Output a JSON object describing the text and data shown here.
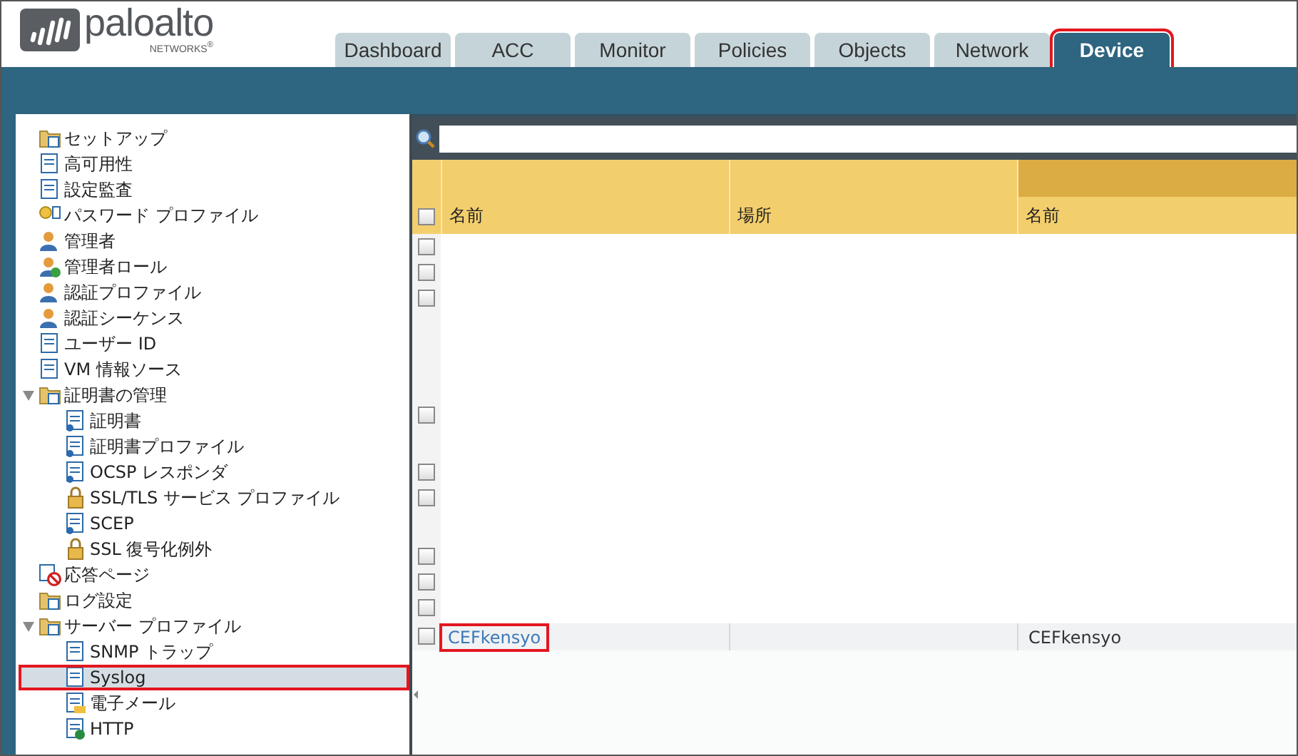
{
  "logo": {
    "name": "paloalto",
    "subtitle": "NETWORKS$^{®}$"
  },
  "tabs": [
    {
      "label": "Dashboard",
      "selected": false,
      "highlighted": false
    },
    {
      "label": "ACC",
      "selected": false,
      "highlighted": false
    },
    {
      "label": "Monitor",
      "selected": false,
      "highlighted": false
    },
    {
      "label": "Policies",
      "selected": false,
      "highlighted": false
    },
    {
      "label": "Objects",
      "selected": false,
      "highlighted": false
    },
    {
      "label": "Network",
      "selected": false,
      "highlighted": false
    },
    {
      "label": "Device",
      "selected": true,
      "highlighted": true
    }
  ],
  "sidebar": {
    "items": [
      {
        "label": "セットアップ",
        "selected": false,
        "highlighted": false
      },
      {
        "label": "高可用性",
        "selected": false,
        "highlighted": false
      },
      {
        "label": "設定監査",
        "selected": false,
        "highlighted": false
      },
      {
        "label": "パスワード プロファイル",
        "selected": false,
        "highlighted": false
      },
      {
        "label": "管理者",
        "selected": false,
        "highlighted": false
      },
      {
        "label": "管理者ロール",
        "selected": false,
        "highlighted": false
      },
      {
        "label": "認証プロファイル",
        "selected": false,
        "highlighted": false
      },
      {
        "label": "認証シーケンス",
        "selected": false,
        "highlighted": false
      },
      {
        "label": "ユーザー ID",
        "selected": false,
        "highlighted": false
      },
      {
        "label": "VM 情報ソース",
        "selected": false,
        "highlighted": false
      },
      {
        "label": "証明書の管理",
        "selected": false,
        "highlighted": false,
        "expanded": true,
        "children": [
          {
            "label": "証明書",
            "selected": false,
            "highlighted": false
          },
          {
            "label": "証明書プロファイル",
            "selected": false,
            "highlighted": false
          },
          {
            "label": "OCSP レスポンダ",
            "selected": false,
            "highlighted": false
          },
          {
            "label": "SSL/TLS サービス プロファイル",
            "selected": false,
            "highlighted": false
          },
          {
            "label": "SCEP",
            "selected": false,
            "highlighted": false
          },
          {
            "label": "SSL 復号化例外",
            "selected": false,
            "highlighted": false
          }
        ]
      },
      {
        "label": "応答ページ",
        "selected": false,
        "highlighted": false
      },
      {
        "label": "ログ設定",
        "selected": false,
        "highlighted": false
      },
      {
        "label": "サーバー プロファイル",
        "selected": false,
        "highlighted": false,
        "expanded": true,
        "children": [
          {
            "label": "SNMP トラップ",
            "selected": false,
            "highlighted": false
          },
          {
            "label": "Syslog",
            "selected": true,
            "highlighted": true
          },
          {
            "label": "電子メール",
            "selected": false,
            "highlighted": false
          },
          {
            "label": "HTTP",
            "selected": false,
            "highlighted": false
          }
        ]
      }
    ]
  },
  "table": {
    "select_all": {
      "checked": false
    },
    "columns": [
      "名前",
      "場所",
      "名前"
    ],
    "rows": [
      {
        "checked": false
      },
      {
        "checked": false
      },
      {
        "checked": false
      },
      {
        "checked": false
      },
      {
        "checked": false
      },
      {
        "checked": false
      },
      {
        "checked": false
      },
      {
        "checked": false
      },
      {
        "checked": false
      },
      {
        "checked": false,
        "name": "CEFkensyo",
        "name_highlighted": true,
        "column_3": "CEFkensyo"
      }
    ]
  }
}
